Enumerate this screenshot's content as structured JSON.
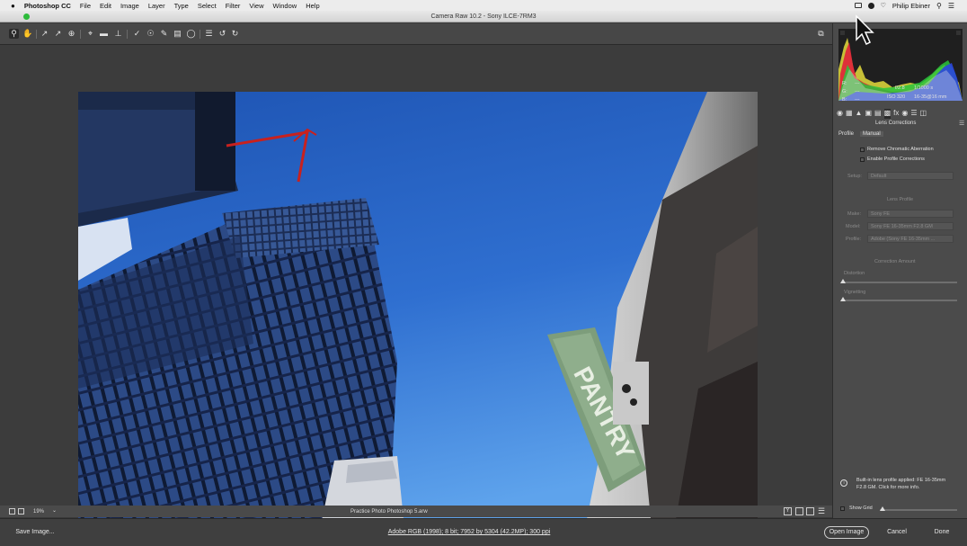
{
  "menubar": {
    "apple": "",
    "app_name": "Photoshop CC",
    "menus": [
      "File",
      "Edit",
      "Image",
      "Layer",
      "Type",
      "Select",
      "Filter",
      "View",
      "Window",
      "Help"
    ],
    "user": "Philip Ebiner"
  },
  "window": {
    "title": "Camera Raw 10.2  -  Sony ILCE-7RM3"
  },
  "photo": {
    "sign_text": "PANTRY"
  },
  "status": {
    "zoom": "19%",
    "filename": "Practice Photo Photoshop 5.arw"
  },
  "panel": {
    "rgb_labels": [
      "R:",
      "G:",
      "B:"
    ],
    "rgb_values": [
      "---",
      "---",
      "---"
    ],
    "exif": {
      "aperture": "f/2.8",
      "shutter": "1/1000 s",
      "iso": "ISO 320",
      "lens": "16-35@16 mm"
    },
    "section_title": "Lens Corrections",
    "tabs": [
      "Profile",
      "Manual"
    ],
    "checkboxes": [
      "Remove Chromatic Aberration",
      "Enable Profile Corrections"
    ],
    "setup_label": "Setup:",
    "setup_value": "Default",
    "lens_profile_heading": "Lens Profile",
    "make_label": "Make:",
    "make_value": "Sony FE",
    "model_label": "Model:",
    "model_value": "Sony FE 16-35mm F2.8 GM",
    "profile_label": "Profile:",
    "profile_value": "Adobe (Sony FE 16-35mm ...",
    "correction_heading": "Correction Amount",
    "distortion_label": "Distortion",
    "vignetting_label": "Vignetting",
    "info_text_1": "Built-in lens profile applied: FE 16-35mm",
    "info_text_2": "F2.8 GM.  Click for more info.",
    "show_grid": "Show Grid"
  },
  "bottom": {
    "save_label": "Save Image...",
    "workflow": "Adobe RGB (1998); 8 bit; 7952 by 5304 (42.2MP); 300 ppi",
    "open_label": "Open Image",
    "cancel_label": "Cancel",
    "done_label": "Done"
  },
  "colors": {
    "sky": "#2f67c6",
    "panel": "#4b4b4b",
    "accent": "#2dbb3b"
  }
}
